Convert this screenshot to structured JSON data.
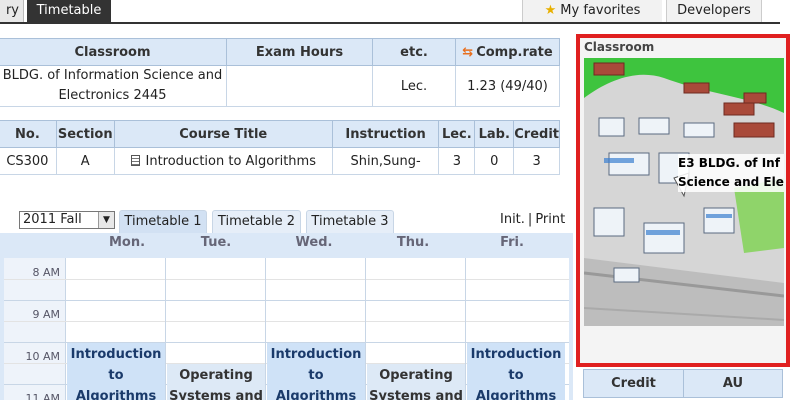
{
  "topbar": {
    "history_label": "ry",
    "timetable_label": "Timetable",
    "favorites_label": "My favorites",
    "developers_label": "Developers"
  },
  "classroom_table": {
    "headers": [
      "Classroom",
      "Exam Hours",
      "etc.",
      "Comp.rate"
    ],
    "row": {
      "classroom": "BLDG. of Information Science and Electronics 2445",
      "exam_hours": "",
      "etc": "Lec.",
      "comp_rate": "1.23 (49/40)"
    }
  },
  "course_table": {
    "headers": [
      "No.",
      "Section",
      "Course Title",
      "Instruction",
      "Lec.",
      "Lab.",
      "Credit"
    ],
    "row": {
      "no": "CS300",
      "section": "A",
      "title": "Introduction to Algorithms",
      "instruction": "Shin,Sung-",
      "lec": "3",
      "lab": "0",
      "credit": "3"
    }
  },
  "controls": {
    "semester": "2011 Fall",
    "tabs": [
      "Timetable 1",
      "Timetable 2",
      "Timetable 3"
    ],
    "init_label": "Init.",
    "separator": "|",
    "print_label": "Print"
  },
  "timetable": {
    "days": [
      "Mon.",
      "Tue.",
      "Wed.",
      "Thu.",
      "Fri."
    ],
    "times": [
      "8 AM",
      "9 AM",
      "10 AM",
      "11 AM"
    ],
    "courses": {
      "mon": "Introduction to Algorithms",
      "tue": "Operating Systems and",
      "wed": "Introduction to Algorithms",
      "thu": "Operating Systems and",
      "fri": "Introduction to Algorithms"
    }
  },
  "map_panel": {
    "title": "Classroom",
    "label_line1": "E3 BLDG. of Inf",
    "label_line2": "Science and Ele"
  },
  "summary_table": {
    "headers": [
      "Credit",
      "AU"
    ]
  },
  "colors": {
    "header_bg": "#dbe8f7",
    "course_block": "#cfe2f7",
    "highlight_border": "#e02020"
  }
}
